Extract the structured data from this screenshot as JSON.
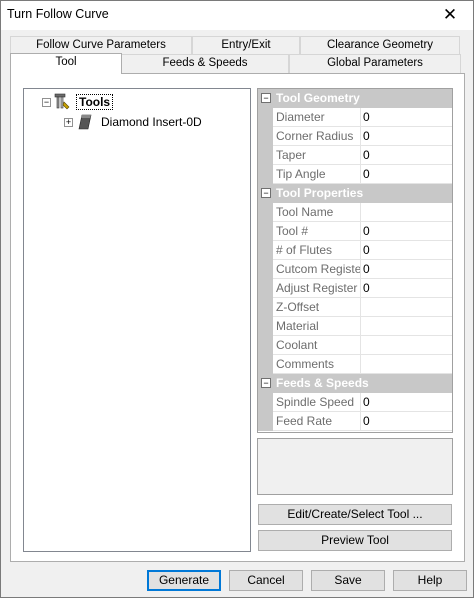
{
  "window": {
    "title": "Turn Follow Curve",
    "close_glyph": "✕"
  },
  "tabs": [
    {
      "label": "Follow Curve Parameters"
    },
    {
      "label": "Entry/Exit"
    },
    {
      "label": "Clearance Geometry"
    },
    {
      "label": "Tool",
      "active": true
    },
    {
      "label": "Feeds & Speeds"
    },
    {
      "label": "Global Parameters"
    }
  ],
  "tree": {
    "root": {
      "label": "Tools",
      "expander": "−",
      "icon": "tools-icon"
    },
    "child": {
      "label": "Diamond Insert-0D",
      "expander": "+",
      "icon": "diamond-insert-icon"
    }
  },
  "property_grid": {
    "categories": [
      {
        "label": "Tool Geometry",
        "toggle": "−",
        "properties": [
          {
            "name": "Diameter",
            "value": "0"
          },
          {
            "name": "Corner Radius",
            "value": "0"
          },
          {
            "name": "Taper",
            "value": "0"
          },
          {
            "name": "Tip Angle",
            "value": "0"
          }
        ]
      },
      {
        "label": "Tool Properties",
        "toggle": "−",
        "properties": [
          {
            "name": "Tool Name",
            "value": ""
          },
          {
            "name": "Tool #",
            "value": "0"
          },
          {
            "name": "# of Flutes",
            "value": "0"
          },
          {
            "name": "Cutcom Registe",
            "value": "0"
          },
          {
            "name": "Adjust Register",
            "value": "0"
          },
          {
            "name": "Z-Offset",
            "value": ""
          },
          {
            "name": "Material",
            "value": ""
          },
          {
            "name": "Coolant",
            "value": ""
          },
          {
            "name": "Comments",
            "value": ""
          }
        ]
      },
      {
        "label": "Feeds & Speeds",
        "toggle": "−",
        "properties": [
          {
            "name": "Spindle Speed",
            "value": "0"
          },
          {
            "name": "Feed Rate",
            "value": "0"
          }
        ]
      }
    ]
  },
  "buttons": {
    "edit_tool": "Edit/Create/Select Tool ...",
    "preview_tool": "Preview Tool",
    "generate": "Generate",
    "cancel": "Cancel",
    "save": "Save",
    "help": "Help"
  },
  "colors": {
    "category_bg": "#c8c8c8",
    "accent": "#0078d7"
  }
}
